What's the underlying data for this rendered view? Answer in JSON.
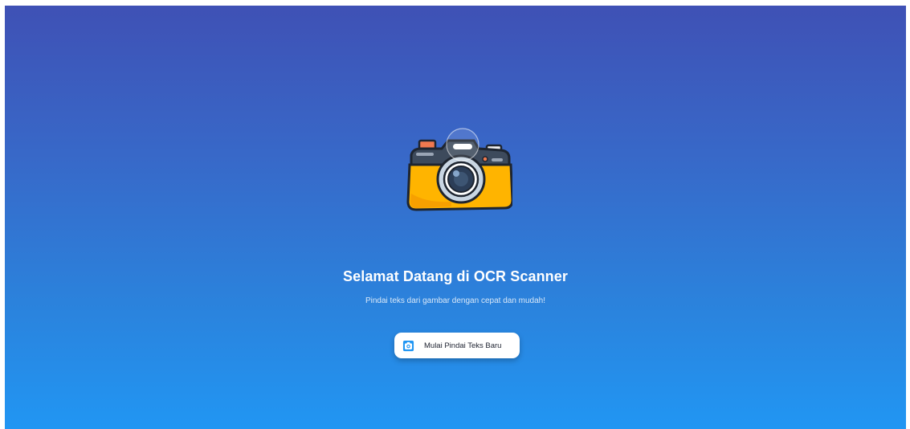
{
  "welcome": {
    "title": "Selamat Datang di OCR Scanner",
    "subtitle": "Pindai teks dari gambar dengan cepat dan mudah!"
  },
  "illustration": {
    "icon": "camera-illustration-icon"
  },
  "actions": {
    "start_scan_label": "Mulai Pindai Teks Baru",
    "start_scan_icon": "camera-icon"
  },
  "colors": {
    "gradient_top": "#3f51b5",
    "gradient_bottom": "#2196f3",
    "camera_body": "#ffb400",
    "camera_top": "#3d4a5c",
    "button_bg": "#ffffff",
    "button_icon": "#2196f3"
  }
}
